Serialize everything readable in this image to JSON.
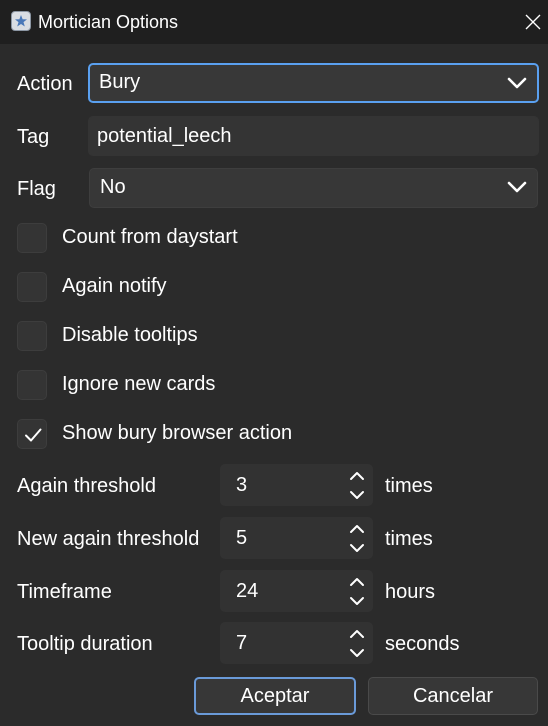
{
  "window": {
    "title": "Mortician Options",
    "icon": "mortician-app-icon",
    "close_icon": "close-icon"
  },
  "fields": {
    "action": {
      "label": "Action",
      "value": "Bury",
      "icon": "chevron-down-icon"
    },
    "tag": {
      "label": "Tag",
      "value": "potential_leech"
    },
    "flag": {
      "label": "Flag",
      "value": "No",
      "icon": "chevron-down-icon"
    }
  },
  "checkboxes": [
    {
      "label": "Count from daystart",
      "checked": false
    },
    {
      "label": "Again notify",
      "checked": false
    },
    {
      "label": "Disable tooltips",
      "checked": false
    },
    {
      "label": "Ignore new cards",
      "checked": false
    },
    {
      "label": "Show bury browser action",
      "checked": true
    }
  ],
  "spinners": [
    {
      "label": "Again threshold",
      "value": "3",
      "unit": "times"
    },
    {
      "label": "New again threshold",
      "value": "5",
      "unit": "times"
    },
    {
      "label": "Timeframe",
      "value": "24",
      "unit": "hours"
    },
    {
      "label": "Tooltip duration",
      "value": "7",
      "unit": "seconds"
    }
  ],
  "buttons": {
    "ok": "Aceptar",
    "cancel": "Cancelar"
  },
  "colors": {
    "accent": "#5aa0f0",
    "background": "#2b2b2b",
    "titlebar": "#1f1f1f"
  }
}
